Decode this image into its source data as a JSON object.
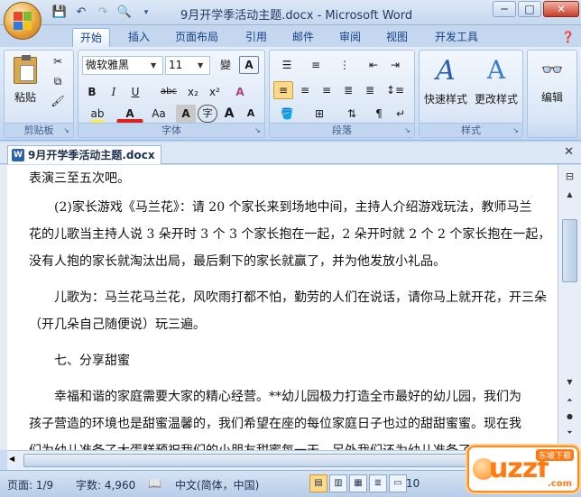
{
  "window": {
    "title": "9月开学季活动主题.docx - Microsoft Word",
    "minimize": "─",
    "maximize": "□",
    "close": "✕"
  },
  "quick_access": {
    "save_icon": "save-icon",
    "undo_icon": "undo-icon",
    "redo_icon": "redo-icon",
    "print_preview_icon": "print-preview-icon"
  },
  "tabs": [
    "开始",
    "插入",
    "页面布局",
    "引用",
    "邮件",
    "审阅",
    "视图",
    "开发工具"
  ],
  "ribbon": {
    "clipboard": {
      "paste_label": "粘贴",
      "group_label": "剪贴板"
    },
    "font": {
      "font_name": "微软雅黑",
      "font_size": "11",
      "group_label": "字体",
      "wen_button": "變",
      "char_border": "A",
      "bold": "B",
      "italic": "I",
      "underline": "U",
      "strike": "abc",
      "subscript": "x₂",
      "superscript": "x²",
      "clear_format": "A",
      "font_color": "A",
      "change_case": "Aa",
      "char_shading": "A",
      "enclose": "字",
      "grow": "A",
      "shrink": "A"
    },
    "paragraph": {
      "group_label": "段落"
    },
    "styles": {
      "quick_styles": "快速样式",
      "change_styles": "更改样式",
      "group_label": "样式"
    },
    "editing": {
      "label": "编辑"
    }
  },
  "document": {
    "tab_label": "9月开学季活动主题.docx",
    "lines": [
      "表演三至五次吧。",
      "(2)家长游戏《马兰花》：请 20 个家长来到场地中间，主持人介绍游戏玩法，教师马兰",
      "花的儿歌当主持人说 3 朵开时 3 个 3 个家长抱在一起，2 朵开时就 2 个 2 个家长抱在一起，",
      "没有人抱的家长就淘汰出局，最后剩下的家长就赢了，并为他发放小礼品。",
      "儿歌为：马兰花马兰花，风吹雨打都不怕，勤劳的人们在说话，请你马上就开花，开三朵",
      "（开几朵自己随便说）玩三遍。",
      "七、分享甜蜜",
      "幸福和谐的家庭需要大家的精心经营。**幼儿园极力打造全市最好的幼儿园，我们为",
      "孩子营造的环境也是甜蜜温馨的，我们希望在座的每位家庭日子也过的甜甜蜜蜜。现在我",
      "们为幼儿准备了大蛋糕预祝我们的小朋友甜蜜每一天，另外我们还为幼儿准备了一份'伤领"
    ]
  },
  "status": {
    "page": "页面: 1/9",
    "words": "字数: 4,960",
    "language": "中文(简体，中国)",
    "zoom": "10"
  },
  "watermark": {
    "text": "uzzf",
    "sub": "东坡下载",
    "domain": ".com"
  }
}
